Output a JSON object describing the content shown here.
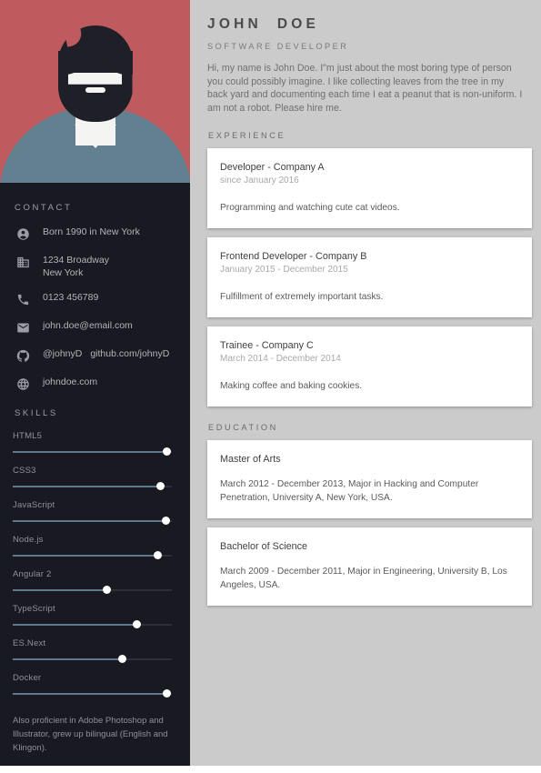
{
  "header": {
    "name": "JOHN  DOE",
    "role": "SOFTWARE DEVELOPER",
    "intro": "Hi, my name is John Doe. I\"m just about the most boring type of person you could possibly imagine. I like collecting leaves from the tree in my back yard and documenting each time I eat a peanut that is non-uniform. I am not a robot. Please hire me."
  },
  "sidebar": {
    "contact_heading": "CONTACT",
    "skills_heading": "SKILLS",
    "contact": [
      {
        "icon": "person-circle-icon",
        "text": "Born 1990 in New York"
      },
      {
        "icon": "building-icon",
        "text": "1234 Broadway\nNew York"
      },
      {
        "icon": "phone-icon",
        "text": "0123 456789"
      },
      {
        "icon": "envelope-icon",
        "text": "john.doe@email.com"
      },
      {
        "icon": "github-icon",
        "text": "@johnyD",
        "text2": "github.com/johnyD"
      },
      {
        "icon": "globe-icon",
        "text": "johndoe.com"
      }
    ],
    "skills": [
      {
        "label": "HTML5",
        "value": 97
      },
      {
        "label": "CSS3",
        "value": 93
      },
      {
        "label": "JavaScript",
        "value": 96
      },
      {
        "label": "Node.js",
        "value": 91
      },
      {
        "label": "Angular 2",
        "value": 59
      },
      {
        "label": "TypeScript",
        "value": 78
      },
      {
        "label": "ES.Next",
        "value": 69
      },
      {
        "label": "Docker",
        "value": 97
      }
    ],
    "note": "Also proficient in Adobe Photoshop and Illustrator, grew up bilingual (English and Klingon)."
  },
  "experience": {
    "heading": "EXPERIENCE",
    "items": [
      {
        "title": "Developer - Company A",
        "date": "since January 2016",
        "desc": "Programming and watching cute cat videos."
      },
      {
        "title": "Frontend Developer - Company B",
        "date": "January 2015 - December 2015",
        "desc": "Fulfillment of extremely important tasks."
      },
      {
        "title": "Trainee - Company C",
        "date": "March 2014 - December 2014",
        "desc": "Making coffee and baking cookies."
      }
    ]
  },
  "education": {
    "heading": "EDUCATION",
    "items": [
      {
        "title": "Master of Arts",
        "desc": "March 2012 - December 2013, Major in Hacking and Computer Penetration, University A, New York, USA."
      },
      {
        "title": "Bachelor of Science",
        "desc": "March 2009 - December 2011, Major in Engineering, University B, Los Angeles, USA."
      }
    ]
  },
  "colors": {
    "avatar_bg": "#bf5a5f",
    "sidebar_bg": "#191a21",
    "page_bg": "#cbcbcb",
    "card_bg": "#ffffff",
    "skill_fill": "#5c7b8e",
    "shirt": "#62808f",
    "hair": "#1f2027",
    "skin": "#f4f4f2"
  }
}
